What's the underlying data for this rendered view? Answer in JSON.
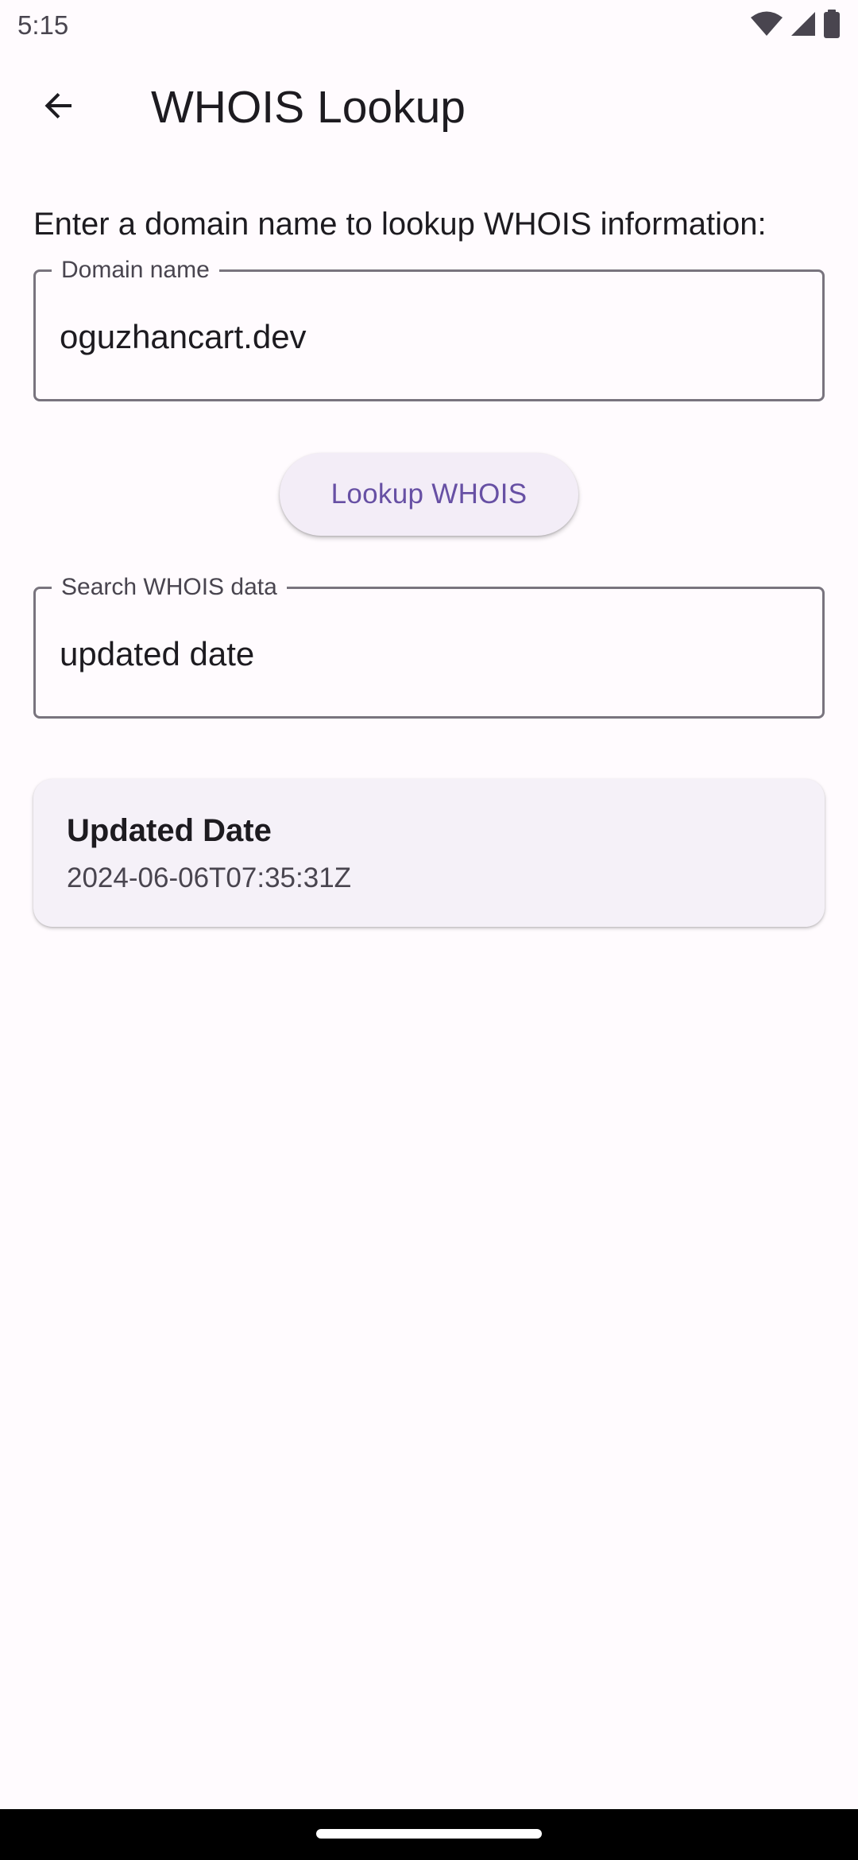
{
  "status_bar": {
    "time": "5:15",
    "icons": [
      "wifi-icon",
      "cellular-signal-icon",
      "battery-icon"
    ]
  },
  "app_bar": {
    "back_icon": "arrow-back-icon",
    "title": "WHOIS Lookup"
  },
  "form": {
    "prompt": "Enter a domain name to lookup WHOIS information:",
    "domain_field": {
      "label": "Domain name",
      "value": "oguzhancart.dev"
    },
    "lookup_button_label": "Lookup WHOIS",
    "search_field": {
      "label": "Search WHOIS data",
      "value": "updated date"
    }
  },
  "results": [
    {
      "title": "Updated Date",
      "value": "2024-06-06T07:35:31Z"
    }
  ],
  "colors": {
    "background": "#fffbfe",
    "primary": "#6750a4",
    "card": "#f5f1f8",
    "outline": "#79747e"
  }
}
